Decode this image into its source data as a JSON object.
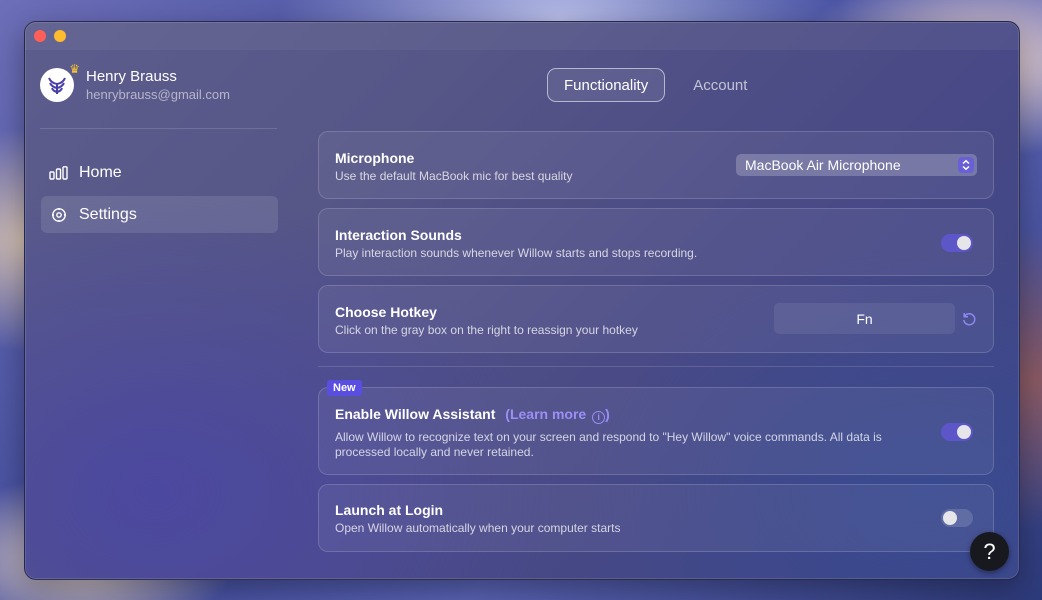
{
  "profile": {
    "name": "Henry Brauss",
    "email": "henrybrauss@gmail.com"
  },
  "sidebar": {
    "items": [
      {
        "label": "Home",
        "icon": "chart-bars-icon",
        "selected": false
      },
      {
        "label": "Settings",
        "icon": "gear-icon",
        "selected": true
      }
    ]
  },
  "tabs": [
    {
      "label": "Functionality",
      "active": true
    },
    {
      "label": "Account",
      "active": false
    }
  ],
  "settings": {
    "microphone": {
      "title": "Microphone",
      "description": "Use the default MacBook mic for best quality",
      "selected_value": "MacBook Air Microphone"
    },
    "interaction_sounds": {
      "title": "Interaction Sounds",
      "description": "Play interaction sounds whenever Willow starts and stops recording.",
      "enabled": true
    },
    "hotkey": {
      "title": "Choose Hotkey",
      "description": "Click on the gray box on the right to reassign your hotkey",
      "value": "Fn"
    },
    "assistant": {
      "badge": "New",
      "title": "Enable Willow Assistant",
      "learn_more": "(Learn more",
      "learn_more_close": ")",
      "info_glyph": "i",
      "description": "Allow Willow to recognize text on your screen and respond to \"Hey Willow\" voice commands. All data is processed locally and never retained.",
      "enabled": true
    },
    "launch_at_login": {
      "title": "Launch at Login",
      "description": "Open Willow automatically when your computer starts",
      "enabled": false
    }
  },
  "help": {
    "label": "?"
  },
  "colors": {
    "accent": "#5d56c9",
    "badge": "#5a4ee0",
    "link": "#9b8ff5"
  }
}
